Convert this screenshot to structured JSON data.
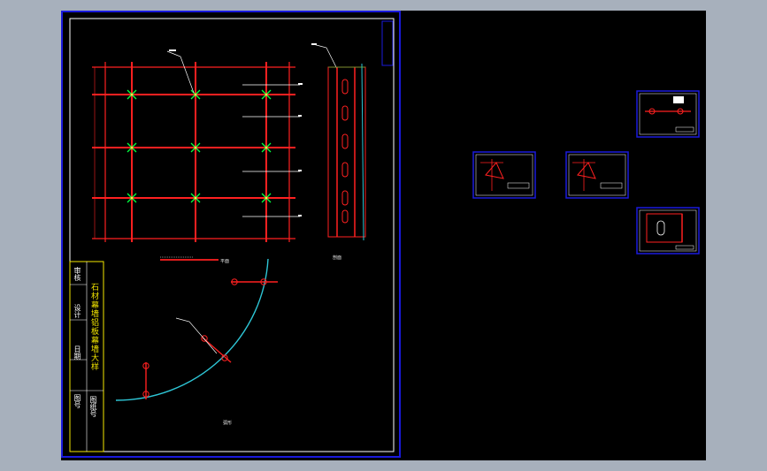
{
  "drawing": {
    "title_block": {
      "cells": [
        "审核",
        "设计",
        "日期",
        "图号"
      ],
      "main_title": "石材幕墙铝板幕墙大样",
      "field_right": "图纸号"
    },
    "callouts": {
      "top_leader": "",
      "section_label": "剖面",
      "plan_label": "平面",
      "curve_label": "弧形"
    },
    "colors": {
      "background": "#000000",
      "frame": "#1a1adc",
      "border": "#ffffff",
      "member": "#ff2020",
      "bolt": "#00ff40",
      "curve": "#2ec6d6",
      "title_fill": "#f5e700"
    }
  }
}
